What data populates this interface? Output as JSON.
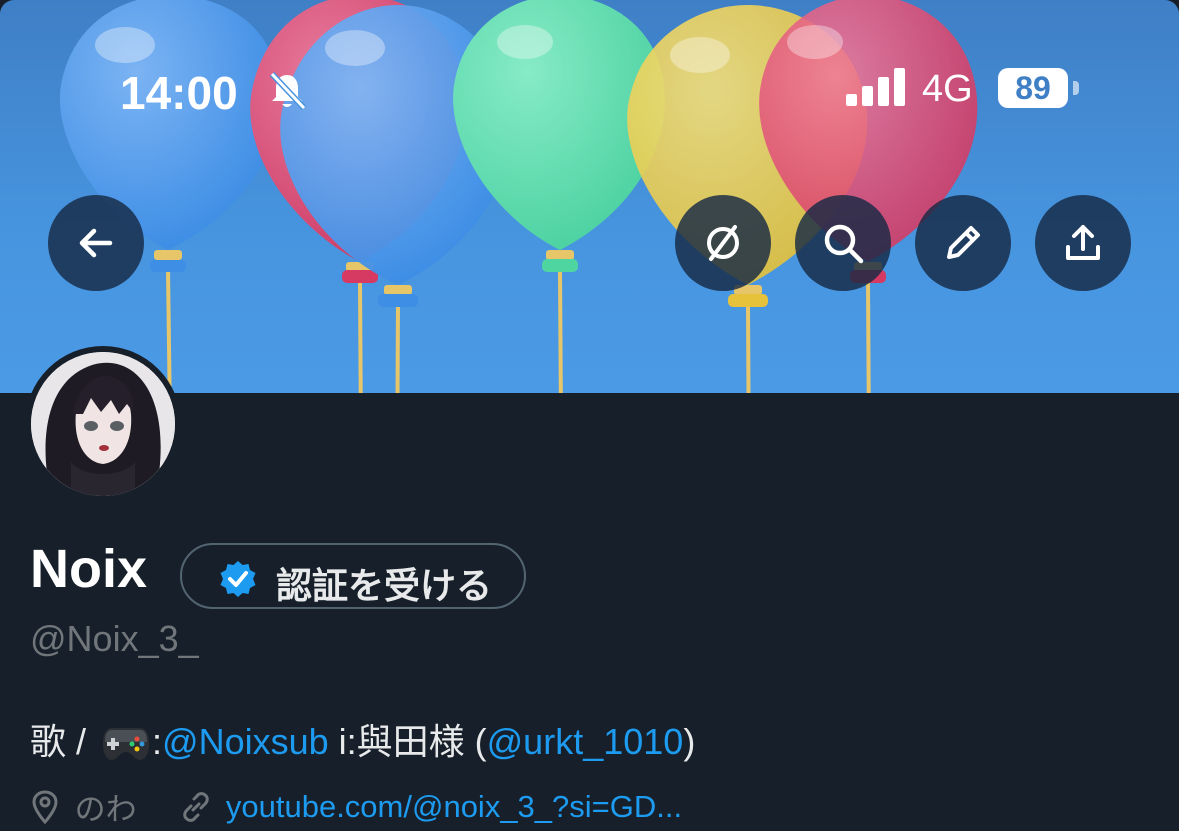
{
  "status_bar": {
    "time": "14:00",
    "network": "4G",
    "battery": "89"
  },
  "header_actions": {
    "back": "back-arrow-icon",
    "grok": "grok-icon",
    "search": "search-icon",
    "edit": "pencil-icon",
    "share": "share-icon"
  },
  "profile": {
    "name": "Noix",
    "verify_button": "認証を受ける",
    "handle": "@Noix_3_",
    "bio": {
      "prefix": "歌 / ",
      "colon": ":",
      "mention1": "@Noixsub",
      "middle": " i:與田様 (",
      "mention2": "@urkt_1010",
      "suffix": ")"
    },
    "location": "のわ",
    "website": "youtube.com/@noix_3_?si=GD..."
  },
  "colors": {
    "banner": "#4795df",
    "background": "#17202a",
    "link": "#1d9bf0",
    "muted": "#71767b",
    "verified": "#1d9bf0"
  }
}
